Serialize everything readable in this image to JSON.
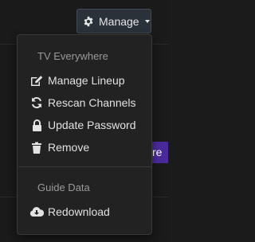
{
  "toolbar": {
    "manage_label": "Manage"
  },
  "background": {
    "partial_button_text": "re"
  },
  "menu": {
    "sections": [
      {
        "header": "TV Everywhere",
        "items": [
          {
            "label": "Manage Lineup",
            "icon": "edit-icon"
          },
          {
            "label": "Rescan Channels",
            "icon": "refresh-icon"
          },
          {
            "label": "Update Password",
            "icon": "lock-icon"
          },
          {
            "label": "Remove",
            "icon": "trash-icon"
          }
        ]
      },
      {
        "header": "Guide Data",
        "items": [
          {
            "label": "Redownload",
            "icon": "cloud-download-icon"
          }
        ]
      }
    ]
  },
  "colors": {
    "background": "#1a1a1a",
    "menu_bg": "#222222",
    "button_bg": "#2a3139",
    "accent_purple": "#4a2a9a"
  }
}
